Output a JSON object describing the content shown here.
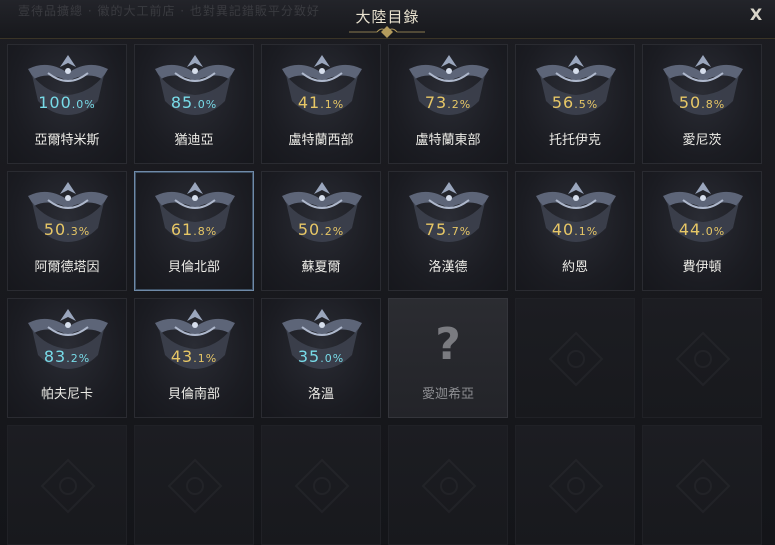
{
  "window": {
    "title": "大陸目錄",
    "close_label": "X",
    "ghost_text": "壹待品擴總 · 徽的大工前店 · 也對異記錯販平分致好"
  },
  "colors": {
    "gold": "#e7c766",
    "cyan": "#78dbe8",
    "selected_border": "#6f8aa8"
  },
  "continents": [
    {
      "name": "亞爾特米斯",
      "pct_int": "100",
      "pct_dec": ".0%",
      "color": "cyan"
    },
    {
      "name": "猶迪亞",
      "pct_int": "85",
      "pct_dec": ".0%",
      "color": "cyan"
    },
    {
      "name": "盧特蘭西部",
      "pct_int": "41",
      "pct_dec": ".1%",
      "color": "gold"
    },
    {
      "name": "盧特蘭東部",
      "pct_int": "73",
      "pct_dec": ".2%",
      "color": "gold"
    },
    {
      "name": "托托伊克",
      "pct_int": "56",
      "pct_dec": ".5%",
      "color": "gold"
    },
    {
      "name": "愛尼茨",
      "pct_int": "50",
      "pct_dec": ".8%",
      "color": "gold"
    },
    {
      "name": "阿爾德塔因",
      "pct_int": "50",
      "pct_dec": ".3%",
      "color": "gold"
    },
    {
      "name": "貝倫北部",
      "pct_int": "61",
      "pct_dec": ".8%",
      "color": "gold",
      "selected": true
    },
    {
      "name": "蘇夏爾",
      "pct_int": "50",
      "pct_dec": ".2%",
      "color": "gold"
    },
    {
      "name": "洛漢德",
      "pct_int": "75",
      "pct_dec": ".7%",
      "color": "gold"
    },
    {
      "name": "約恩",
      "pct_int": "40",
      "pct_dec": ".1%",
      "color": "gold"
    },
    {
      "name": "費伊頓",
      "pct_int": "44",
      "pct_dec": ".0%",
      "color": "gold"
    },
    {
      "name": "帕夫尼卡",
      "pct_int": "83",
      "pct_dec": ".2%",
      "color": "cyan"
    },
    {
      "name": "貝倫南部",
      "pct_int": "43",
      "pct_dec": ".1%",
      "color": "gold"
    },
    {
      "name": "洛溫",
      "pct_int": "35",
      "pct_dec": ".0%",
      "color": "cyan"
    }
  ],
  "locked": {
    "name": "愛迦希亞",
    "symbol": "?"
  }
}
